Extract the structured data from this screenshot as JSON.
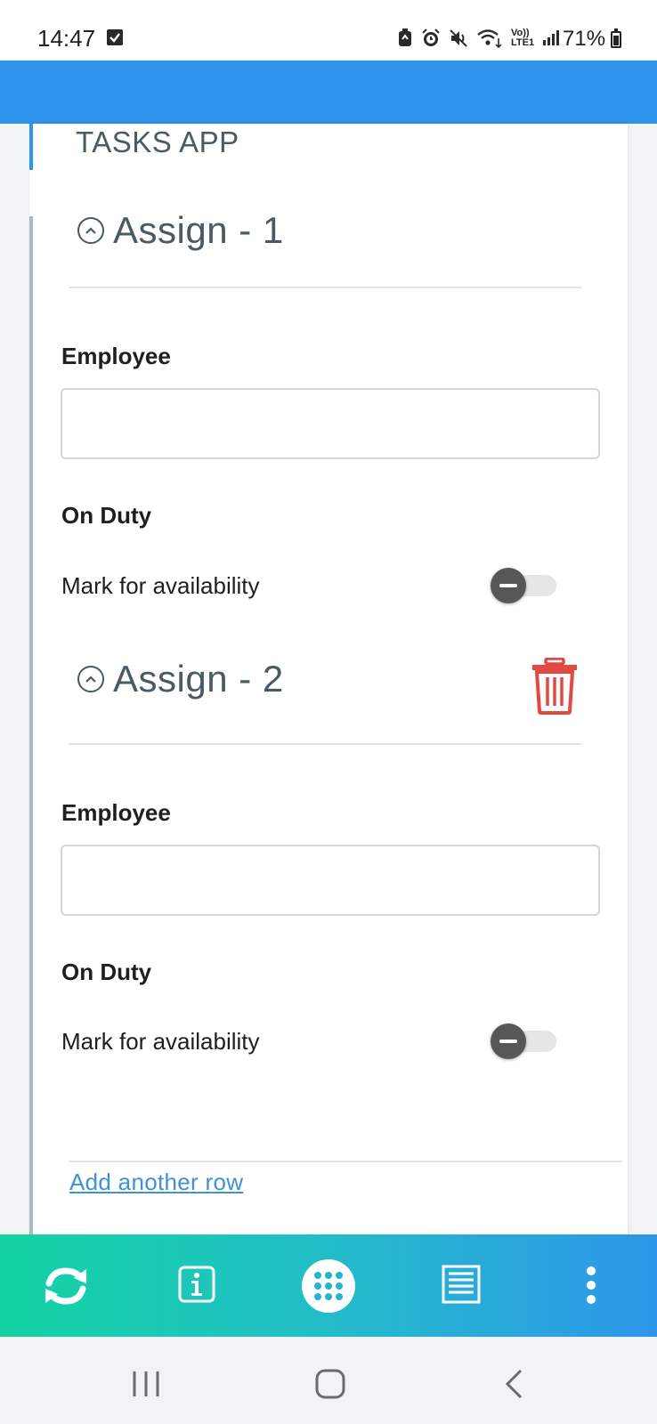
{
  "status_bar": {
    "time": "14:47",
    "network_label_top": "Vo))",
    "network_label_bottom": "LTE1",
    "battery_text": "71%"
  },
  "app": {
    "title": "TASKS APP",
    "accent_color": "#2e93ea"
  },
  "assignments": [
    {
      "title": "Assign - 1",
      "employee_label": "Employee",
      "employee_value": "",
      "on_duty_label": "On Duty",
      "toggle_label": "Mark for availability",
      "toggle_state": "off"
    },
    {
      "title": "Assign - 2",
      "employee_label": "Employee",
      "employee_value": "",
      "on_duty_label": "On Duty",
      "toggle_label": "Mark for availability",
      "toggle_state": "off",
      "delete_icon": "trash-icon",
      "delete_color": "#e04a43"
    }
  ],
  "add_row_label": "Add another row",
  "toolbar": {
    "items": [
      "sync-icon",
      "info-icon",
      "grid-menu-icon",
      "list-icon",
      "more-vertical-icon"
    ]
  },
  "nav": {
    "items": [
      "recent-apps-icon",
      "home-icon",
      "back-icon"
    ]
  }
}
